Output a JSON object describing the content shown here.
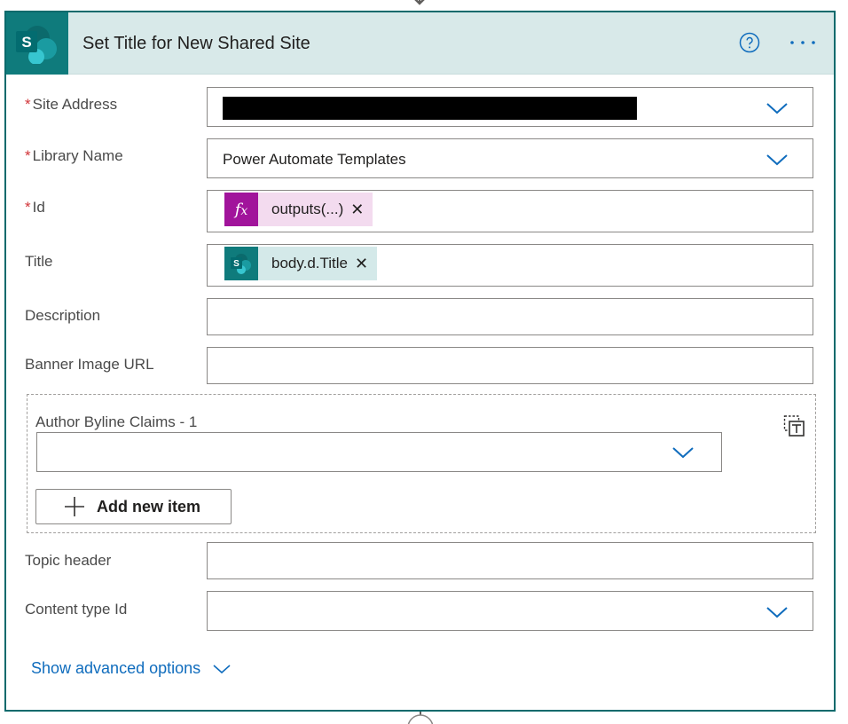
{
  "card": {
    "title": "Set Title for New Shared Site",
    "header_bg": "#d8e9e9",
    "border_color": "#0b6a6c",
    "icons": {
      "app": "sharepoint-icon",
      "help": "help-circle-icon",
      "more": "more-options-icon"
    }
  },
  "fields": {
    "site_address": {
      "label": "Site Address",
      "required": "*",
      "value": ""
    },
    "library_name": {
      "label": "Library Name",
      "required": "*",
      "value": "Power Automate Templates"
    },
    "id": {
      "label": "Id",
      "required": "*",
      "token_label": "outputs(...)",
      "token_icon": "fx-icon",
      "token_color": "#a1149b"
    },
    "title": {
      "label": "Title",
      "token_label": "body.d.Title",
      "token_icon": "sharepoint-icon",
      "token_color": "#0f7b7c"
    },
    "description": {
      "label": "Description",
      "value": ""
    },
    "banner_image_url": {
      "label": "Banner Image URL",
      "value": ""
    },
    "author_byline": {
      "label": "Author Byline Claims - 1",
      "value": "",
      "add_button": "Add new item"
    },
    "topic_header": {
      "label": "Topic header",
      "value": ""
    },
    "content_type_id": {
      "label": "Content type Id",
      "value": ""
    }
  },
  "footer": {
    "advanced_label": "Show advanced options"
  },
  "accent": "#0f6cbd",
  "required_color": "#d13438"
}
